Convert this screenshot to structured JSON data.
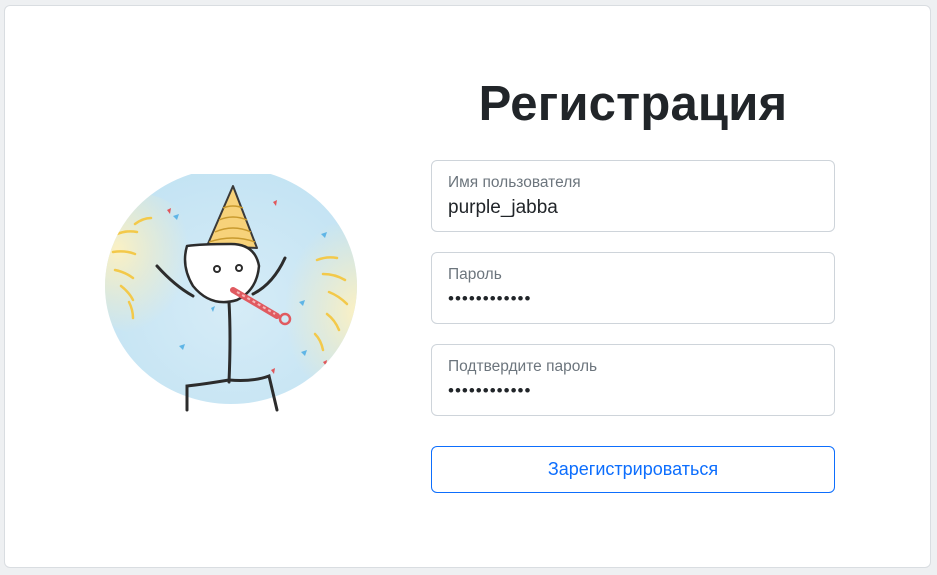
{
  "form": {
    "title": "Регистрация",
    "username": {
      "label": "Имя пользователя",
      "value": "purple_jabba"
    },
    "password": {
      "label": "Пароль",
      "masked_value": "••••••••••••"
    },
    "confirm_password": {
      "label": "Подтвердите пароль",
      "masked_value": "••••••••••••"
    },
    "submit_label": "Зарегистрироваться"
  },
  "colors": {
    "accent": "#0d6efd",
    "title": "#212529",
    "label": "#6c757d",
    "border": "#ced4da"
  },
  "illustration": {
    "icon": "party-stickman-illustration"
  }
}
